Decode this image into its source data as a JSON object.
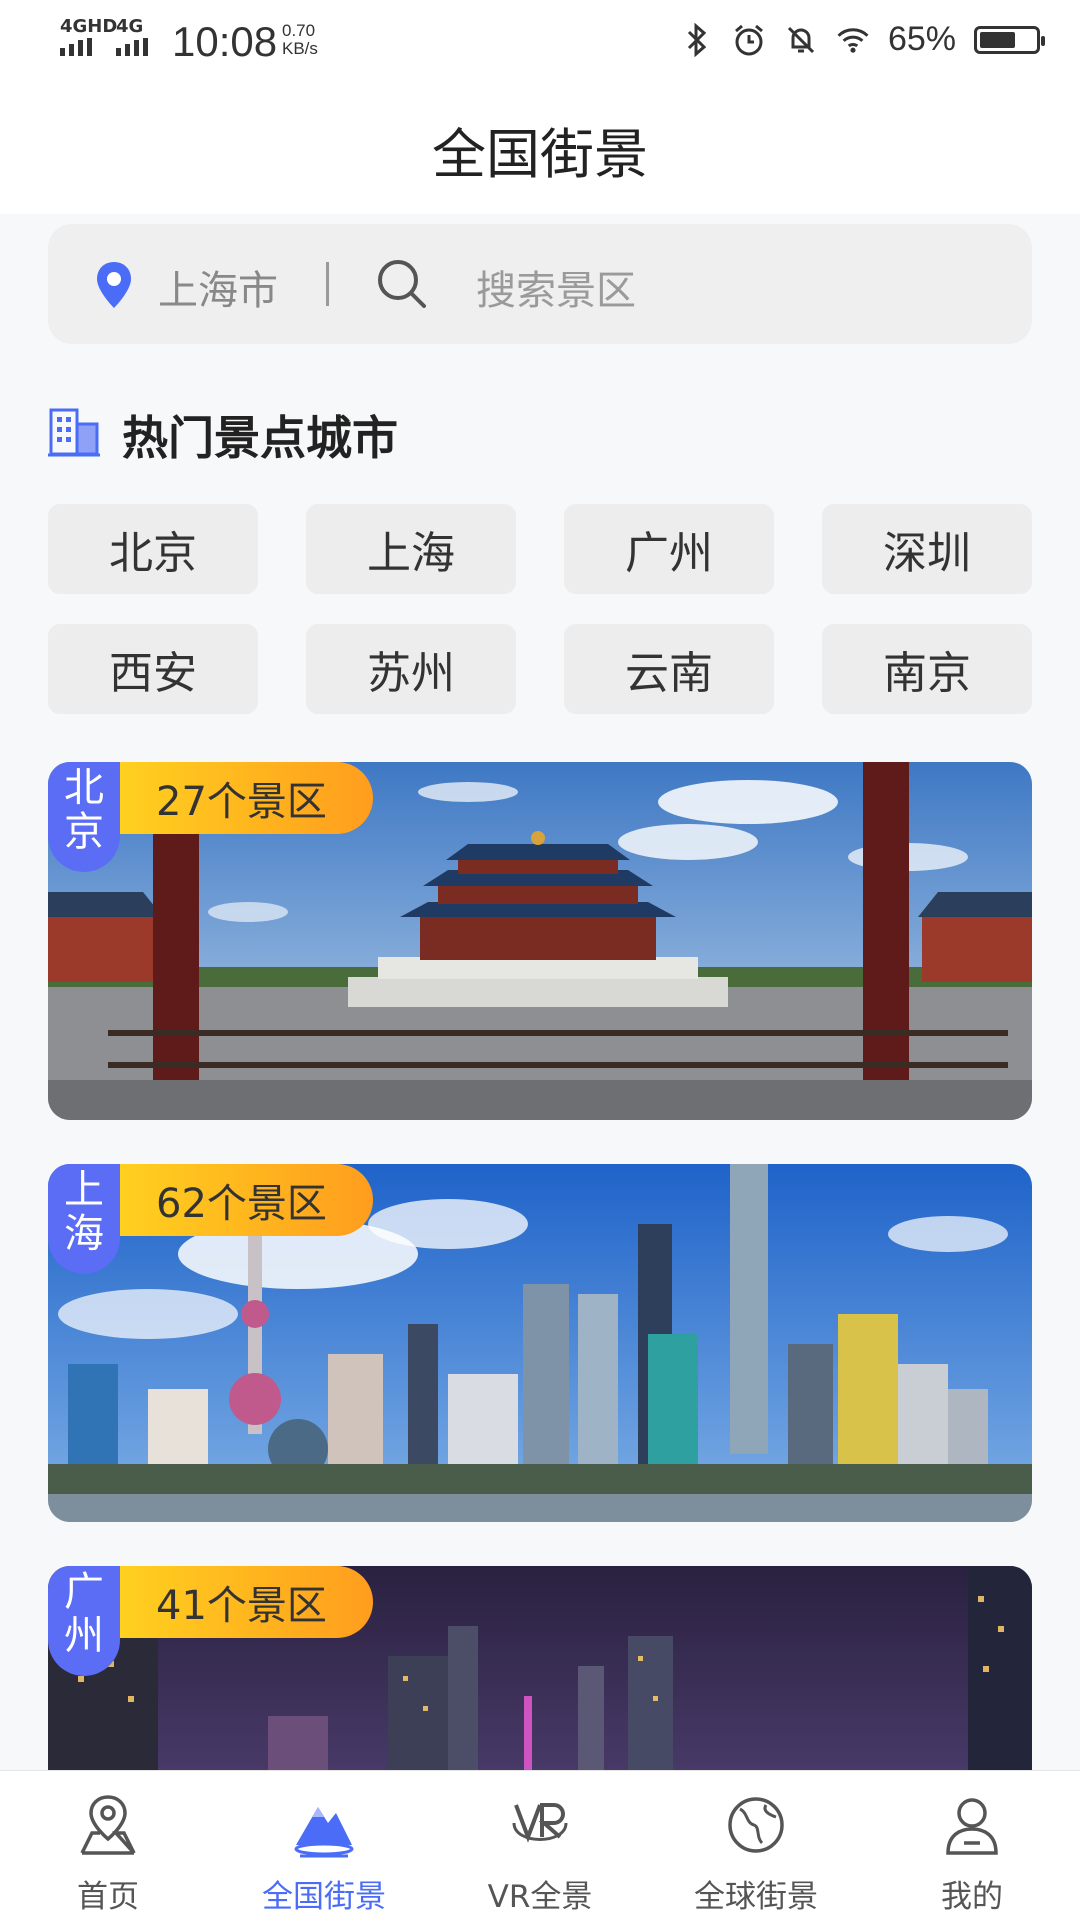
{
  "status_bar": {
    "network1": "4GHD",
    "network2": "4G",
    "time": "10:08",
    "speed_value": "0.70",
    "speed_unit": "KB/s",
    "battery_percent": "65%",
    "battery_level": 0.65,
    "icons": [
      "bluetooth-icon",
      "alarm-icon",
      "mute-icon",
      "wifi-icon",
      "battery-icon"
    ]
  },
  "header": {
    "title": "全国街景"
  },
  "search": {
    "location": "上海市",
    "placeholder": "搜索景区"
  },
  "section": {
    "title": "热门景点城市"
  },
  "cities": [
    "北京",
    "上海",
    "广州",
    "深圳",
    "西安",
    "苏州",
    "云南",
    "南京"
  ],
  "cards": [
    {
      "city": "北京",
      "count": "27个景区"
    },
    {
      "city": "上海",
      "count": "62个景区"
    },
    {
      "city": "广州",
      "count": "41个景区"
    }
  ],
  "bottom_nav": [
    {
      "label": "首页",
      "icon": "map-pin-icon",
      "active": false
    },
    {
      "label": "全国街景",
      "icon": "mountain-icon",
      "active": true
    },
    {
      "label": "VR全景",
      "icon": "vr-icon",
      "active": false
    },
    {
      "label": "全球街景",
      "icon": "globe-icon",
      "active": false
    },
    {
      "label": "我的",
      "icon": "user-icon",
      "active": false
    }
  ],
  "colors": {
    "accent": "#4a6cf7",
    "tag_city": "#5b6cf5",
    "tag_count_start": "#ffd21f",
    "tag_count_end": "#ff9d1e"
  }
}
